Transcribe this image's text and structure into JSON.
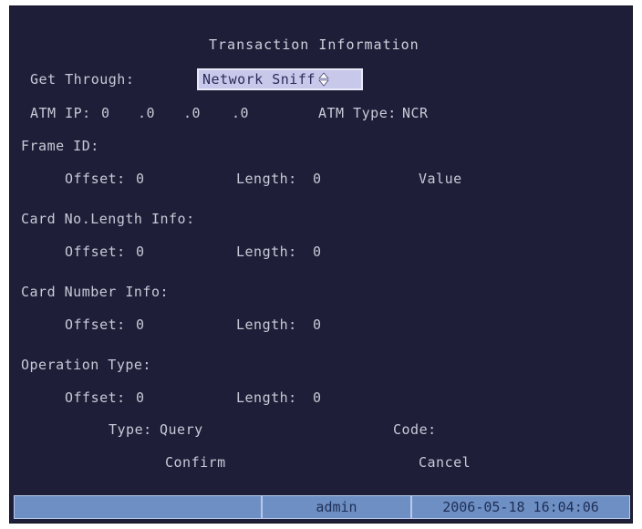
{
  "dialog": {
    "title": "Transaction Information",
    "get_through_label": "Get Through:",
    "get_through_value": "Network Sniff",
    "atm_ip_label": "ATM IP:",
    "atm_ip": [
      "0",
      ".0",
      ".0",
      ".0"
    ],
    "atm_type_label": "ATM Type:",
    "atm_type_value": "NCR"
  },
  "sections": {
    "frame_id": {
      "heading": "Frame ID:",
      "offset_label": "Offset:",
      "offset": "0",
      "length_label": "Length:",
      "length": "0",
      "value_label": "Value"
    },
    "card_no_length": {
      "heading": "Card No.Length Info:",
      "offset_label": "Offset:",
      "offset": "0",
      "length_label": "Length:",
      "length": "0"
    },
    "card_number": {
      "heading": "Card Number Info:",
      "offset_label": "Offset:",
      "offset": "0",
      "length_label": "Length:",
      "length": "0"
    },
    "operation_type": {
      "heading": "Operation Type:",
      "offset_label": "Offset:",
      "offset": "0",
      "length_label": "Length:",
      "length": "0",
      "type_label": "Type:",
      "type_value": "Query",
      "code_label": "Code:",
      "code_value": ""
    }
  },
  "buttons": {
    "confirm": "Confirm",
    "cancel": "Cancel"
  },
  "status_bar": {
    "empty": "",
    "user": "admin",
    "datetime": "2006-05-18 16:04:06"
  },
  "colors": {
    "background": "#1e1e38",
    "text": "#c9c9d8",
    "status_bar": "#6e8fc4",
    "select_fill": "#c8c8ea"
  }
}
